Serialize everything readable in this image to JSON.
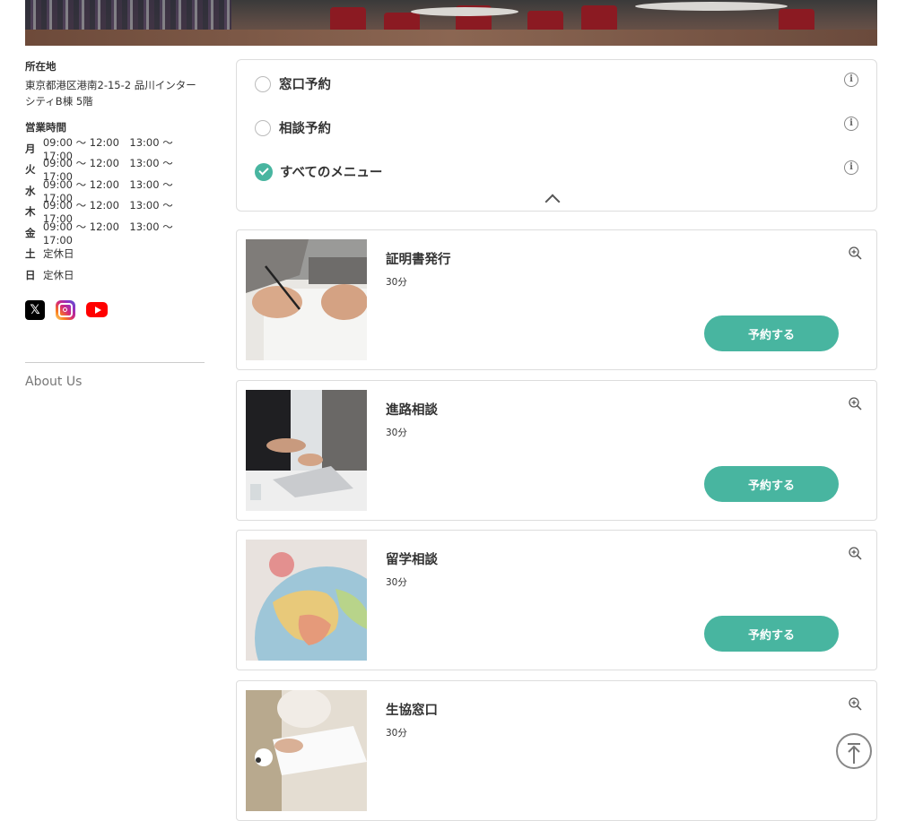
{
  "sidebar": {
    "address_heading": "所在地",
    "address_line1": "東京都港区港南2-15-2 品川インター",
    "address_line2": "シティB棟 5階",
    "hours_heading": "営業時間",
    "hours": [
      {
        "day": "月",
        "time": "09:00 〜 12:00　13:00 〜 17:00"
      },
      {
        "day": "火",
        "time": "09:00 〜 12:00　13:00 〜 17:00"
      },
      {
        "day": "水",
        "time": "09:00 〜 12:00　13:00 〜 17:00"
      },
      {
        "day": "木",
        "time": "09:00 〜 12:00　13:00 〜 17:00"
      },
      {
        "day": "金",
        "time": "09:00 〜 12:00　13:00 〜 17:00"
      },
      {
        "day": "土",
        "time": "定休日"
      },
      {
        "day": "日",
        "time": "定休日"
      }
    ],
    "social": {
      "x_glyph": "𝕏"
    },
    "about_link": "About Us"
  },
  "filters": [
    {
      "label": "窓口予約",
      "checked": false
    },
    {
      "label": "相談予約",
      "checked": false
    },
    {
      "label": "すべてのメニュー",
      "checked": true
    }
  ],
  "info_glyph": "i",
  "menus": [
    {
      "title": "証明書発行",
      "duration": "30分",
      "button": "予約する"
    },
    {
      "title": "進路相談",
      "duration": "30分",
      "button": "予約する"
    },
    {
      "title": "留学相談",
      "duration": "30分",
      "button": "予約する"
    },
    {
      "title": "生協窓口",
      "duration": "30分"
    }
  ],
  "colors": {
    "accent": "#48b5a0"
  }
}
